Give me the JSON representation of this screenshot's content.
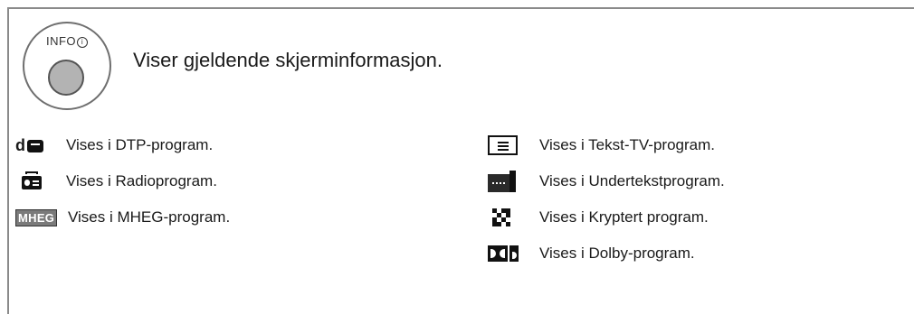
{
  "info_button": {
    "label": "INFO"
  },
  "heading": "Viser gjeldende skjerminformasjon.",
  "left_items": [
    {
      "icon": "dtp-icon",
      "text": "Vises i DTP-program."
    },
    {
      "icon": "radio-icon",
      "text": "Vises i Radioprogram."
    },
    {
      "icon": "mheg-icon",
      "icon_text": "MHEG",
      "text": "Vises i MHEG-program."
    }
  ],
  "right_items": [
    {
      "icon": "teletext-icon",
      "text": "Vises i Tekst-TV-program."
    },
    {
      "icon": "subtitle-icon",
      "text": "Vises i Undertekstprogram."
    },
    {
      "icon": "scrambled-icon",
      "text": "Vises i Kryptert program."
    },
    {
      "icon": "dolby-icon",
      "text": "Vises i Dolby-program."
    }
  ]
}
